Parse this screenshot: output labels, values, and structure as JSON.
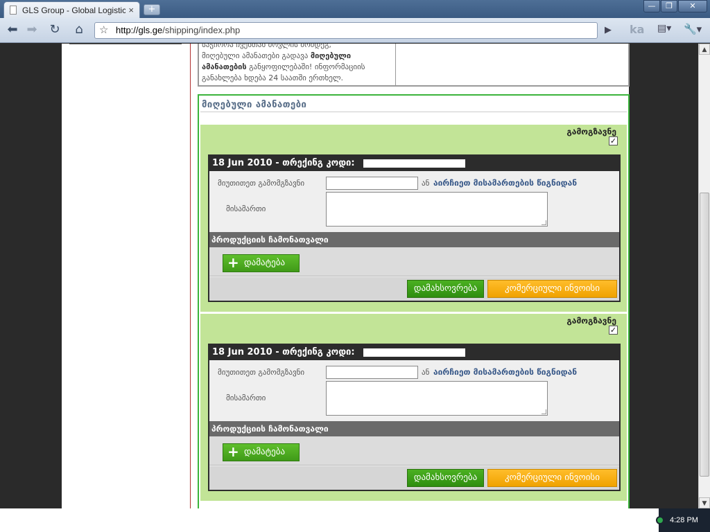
{
  "browser": {
    "tab_title": "GLS Group - Global Logistic...",
    "tab_close": "×",
    "new_tab": "+",
    "url_host": "http://gls.ge",
    "url_path": "/shipping/index.php",
    "lang_indicator": "ka"
  },
  "info": {
    "line1": "საჭიროა ჩვენთან მოვლის მომდეგ,",
    "line2_pre": "მიღებული ამანათები გადავა ",
    "line2_bold": "მიღებული",
    "line3_bold": "ამანათების",
    "line3_post": " განყოფილებაში! ინფორმაციის",
    "line4": "განახლება ხდება 24 საათში ერთხელ."
  },
  "section": {
    "title": "მიღებული ამანათები"
  },
  "items": [
    {
      "send_label": "გამოგზავნე",
      "send_checked": "✓",
      "header": "18 Jun 2010 - თრექინგ კოდი:",
      "sender_label": "მიუთითეთ გამომგზავნი",
      "or_label": "ან",
      "pick_link": "აირჩიეთ მისამართების წიგნიდან",
      "address_label": "მისამართი",
      "products_label": "პროდუქციის ჩამონათვალი",
      "add_button": "დამატება",
      "save_button": "დამახსოვრება",
      "invoice_button": "კომერციული ინვოისი"
    },
    {
      "send_label": "გამოგზავნე",
      "send_checked": "✓",
      "header": "18 Jun 2010 - თრექინგ კოდი:",
      "sender_label": "მიუთითეთ გამომგზავნი",
      "or_label": "ან",
      "pick_link": "აირჩიეთ მისამართების წიგნიდან",
      "address_label": "მისამართი",
      "products_label": "პროდუქციის ჩამონათვალი",
      "add_button": "დამატება",
      "save_button": "დამახსოვრება",
      "invoice_button": "კომერციული ინვოისი"
    }
  ],
  "taskbar": {
    "clock": "4:28 PM"
  }
}
